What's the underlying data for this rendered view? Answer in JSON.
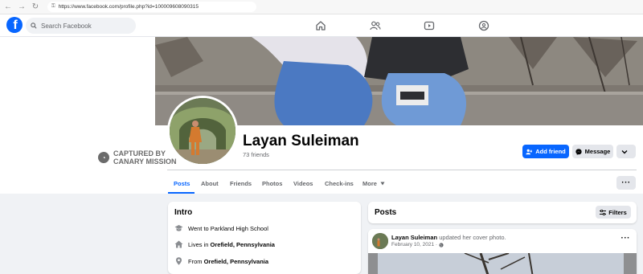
{
  "browser": {
    "url": "https://www.facebook.com/profile.php?id=100009608090315"
  },
  "header": {
    "search_placeholder": "Search Facebook",
    "brand_color": "#0866ff"
  },
  "watermark": {
    "line1": "CAPTURED BY",
    "line2": "CANARY MISSION"
  },
  "profile": {
    "name": "Layan Suleiman",
    "friends": "73 friends",
    "add_friend_label": "Add friend",
    "message_label": "Message"
  },
  "tabs": [
    {
      "label": "Posts",
      "active": true
    },
    {
      "label": "About"
    },
    {
      "label": "Friends"
    },
    {
      "label": "Photos"
    },
    {
      "label": "Videos"
    },
    {
      "label": "Check-ins"
    },
    {
      "label": "More"
    }
  ],
  "intro": {
    "title": "Intro",
    "items": [
      {
        "icon": "graduation-cap-icon",
        "text": "Went to Parkland High School"
      },
      {
        "icon": "home-icon",
        "prefix": "Lives in ",
        "bold": "Orefield, Pennsylvania"
      },
      {
        "icon": "location-pin-icon",
        "prefix": "From ",
        "bold": "Orefield, Pennsylvania"
      }
    ]
  },
  "posts": {
    "title": "Posts",
    "filters_label": "Filters",
    "post": {
      "author": "Layan Suleiman",
      "action": "updated her cover photo.",
      "date": "February 10, 2021 ·"
    }
  }
}
